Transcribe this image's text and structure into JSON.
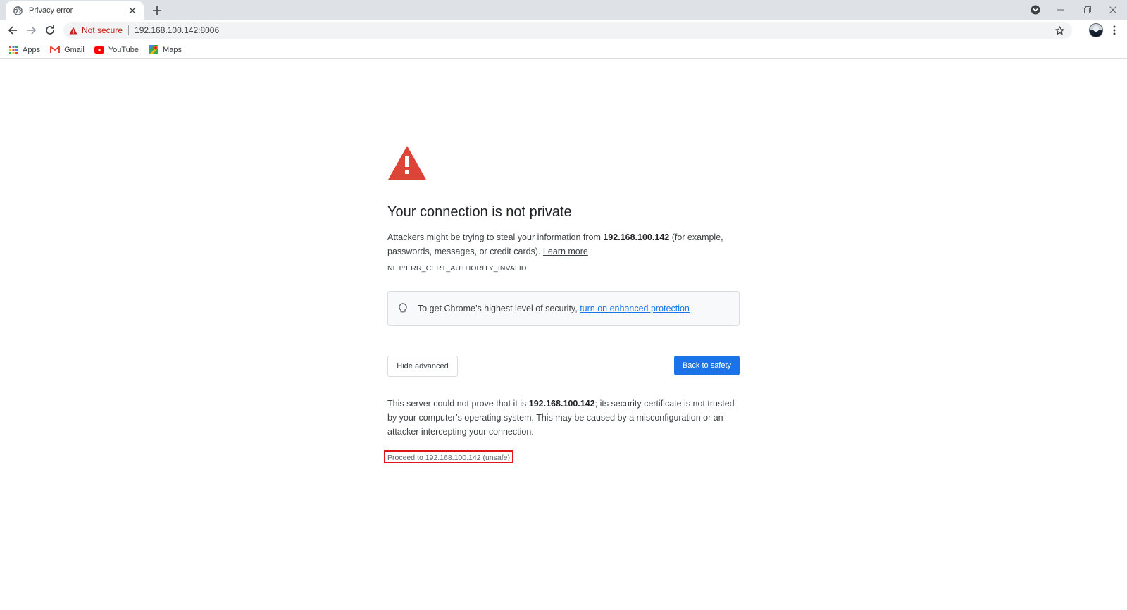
{
  "tab": {
    "title": "Privacy error"
  },
  "toolbar": {
    "security_label": "Not secure",
    "url": "192.168.100.142:8006"
  },
  "bookmarks": [
    {
      "label": "Apps",
      "icon": "apps-grid-icon"
    },
    {
      "label": "Gmail",
      "icon": "gmail-icon"
    },
    {
      "label": "YouTube",
      "icon": "youtube-icon"
    },
    {
      "label": "Maps",
      "icon": "maps-icon"
    }
  ],
  "interstitial": {
    "headline": "Your connection is not private",
    "intro_before": "Attackers might be trying to steal your information from ",
    "host": "192.168.100.142",
    "intro_after": " (for example, passwords, messages, or credit cards). ",
    "learn_more": "Learn more",
    "error_code": "NET::ERR_CERT_AUTHORITY_INVALID",
    "enhanced_text": "To get Chrome’s highest level of security, ",
    "enhanced_link": "turn on enhanced protection",
    "hide_advanced": "Hide advanced",
    "back_to_safety": "Back to safety",
    "details_before": "This server could not prove that it is ",
    "details_host": "192.168.100.142",
    "details_after": "; its security certificate is not trusted by your computer’s operating system. This may be caused by a misconfiguration or an attacker intercepting your connection.",
    "proceed_link": "Proceed to 192.168.100.142 (unsafe)"
  },
  "colors": {
    "warning_red": "#db4437",
    "primary_blue": "#1a73e8",
    "highlight_border": "#e0161b"
  }
}
